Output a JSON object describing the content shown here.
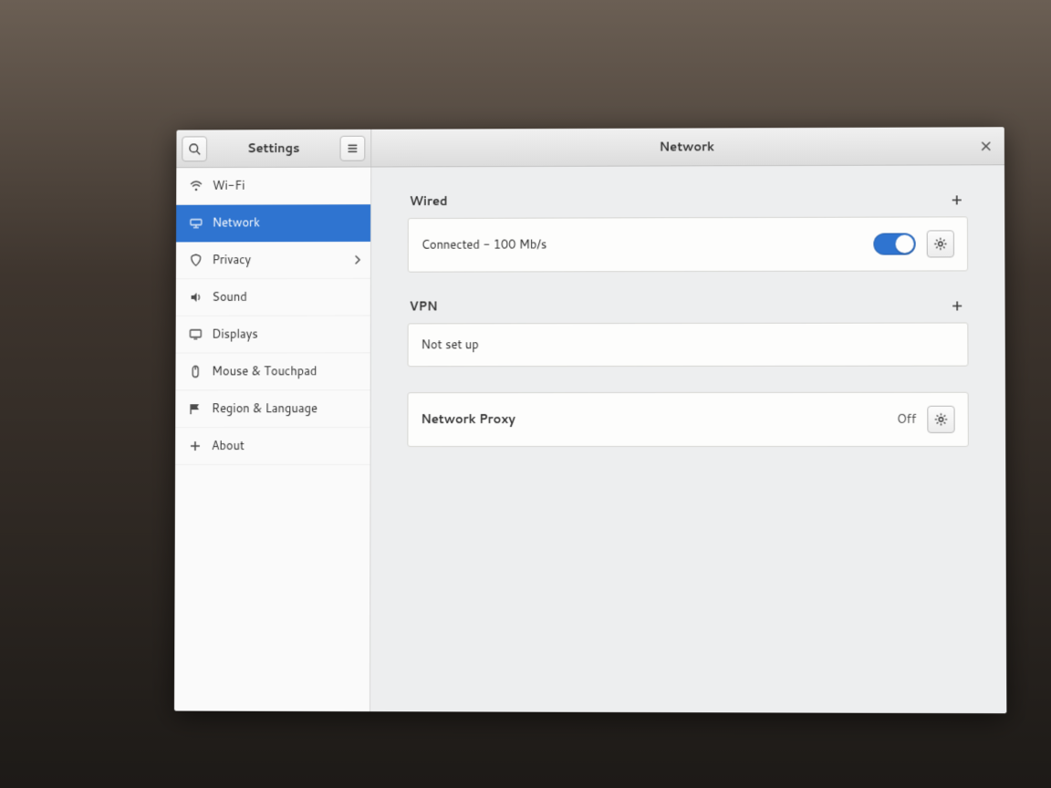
{
  "header": {
    "left_title": "Settings",
    "right_title": "Network"
  },
  "sidebar": {
    "items": [
      {
        "label": "Wi-Fi",
        "icon": "wifi-icon",
        "has_chevron": false
      },
      {
        "label": "Network",
        "icon": "network-icon",
        "has_chevron": false,
        "active": true
      },
      {
        "label": "Privacy",
        "icon": "privacy-icon",
        "has_chevron": true
      },
      {
        "label": "Sound",
        "icon": "sound-icon",
        "has_chevron": false
      },
      {
        "label": "Displays",
        "icon": "displays-icon",
        "has_chevron": false
      },
      {
        "label": "Mouse & Touchpad",
        "icon": "mouse-icon",
        "has_chevron": false
      },
      {
        "label": "Region & Language",
        "icon": "region-icon",
        "has_chevron": false
      },
      {
        "label": "About",
        "icon": "about-icon",
        "has_chevron": false
      }
    ]
  },
  "sections": {
    "wired": {
      "title": "Wired",
      "status": "Connected - 100 Mb/s",
      "switch_on": true
    },
    "vpn": {
      "title": "VPN",
      "status": "Not set up"
    },
    "proxy": {
      "title": "Network Proxy",
      "status": "Off"
    }
  }
}
